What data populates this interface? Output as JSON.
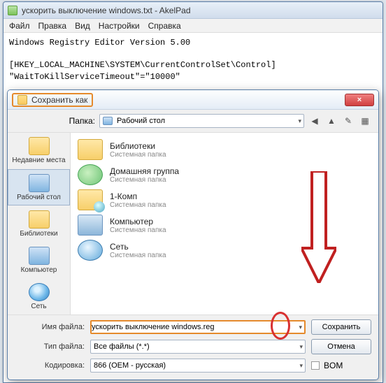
{
  "window": {
    "title": "ускорить выключение windows.txt - AkelPad"
  },
  "menu": {
    "file": "Файл",
    "edit": "Правка",
    "view": "Вид",
    "settings": "Настройки",
    "help": "Справка"
  },
  "editor": {
    "line1": "Windows Registry Editor Version 5.00",
    "line2": "[HKEY_LOCAL_MACHINE\\SYSTEM\\CurrentControlSet\\Control]",
    "line3": "\"WaitToKillServiceTimeout\"=\"10000\""
  },
  "dialog": {
    "title": "Сохранить как",
    "close": "×",
    "folder_label": "Папка:",
    "folder_value": "Рабочий стол",
    "places": {
      "recent": "Недавние места",
      "desktop": "Рабочий стол",
      "libraries": "Библиотеки",
      "computer": "Компьютер",
      "network": "Сеть"
    },
    "items": [
      {
        "name": "Библиотеки",
        "sub": "Системная папка"
      },
      {
        "name": "Домашняя группа",
        "sub": "Системная папка"
      },
      {
        "name": "1-Комп",
        "sub": "Системная папка"
      },
      {
        "name": "Компьютер",
        "sub": "Системная папка"
      },
      {
        "name": "Сеть",
        "sub": "Системная папка"
      }
    ],
    "filename_label": "Имя файла:",
    "filename_value": "ускорить выключение windows.reg",
    "filetype_label": "Тип файла:",
    "filetype_value": "Все файлы (*.*)",
    "encoding_label": "Кодировка:",
    "encoding_value": "866  (OEM - русская)",
    "bom_label": "BOM",
    "save_btn": "Сохранить",
    "cancel_btn": "Отмена"
  }
}
